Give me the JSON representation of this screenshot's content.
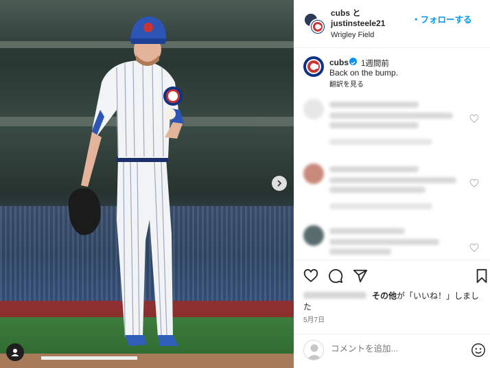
{
  "photo": {
    "cap_letter": "C",
    "crest_text": "cubs",
    "next_icon": "chevron-right-icon",
    "user_icon": "person-icon"
  },
  "header": {
    "line1": "cubs と",
    "line2": "justinsteele21",
    "location": "Wrigley Field",
    "follow_label": "・フォローする",
    "avatar_letter": "C"
  },
  "caption": {
    "username": "cubs",
    "time": "1週間前",
    "text": "Back on the bump.",
    "translate": "翻訳を見る",
    "avatar_letter": "C"
  },
  "actions": {
    "like_icon": "heart-icon",
    "comment_icon": "comment-icon",
    "share_icon": "send-icon",
    "save_icon": "bookmark-icon"
  },
  "likes": {
    "others_bold": "その他",
    "rest": "が「いいね！」しまし",
    "wrap": "た"
  },
  "date": "5月7日",
  "comment_box": {
    "placeholder": "コメントを追加...",
    "emoji_icon": "emoji-icon"
  },
  "colors": {
    "cubs_blue": "#0e3386",
    "cubs_red": "#cc3433",
    "accent": "#0095f6"
  }
}
